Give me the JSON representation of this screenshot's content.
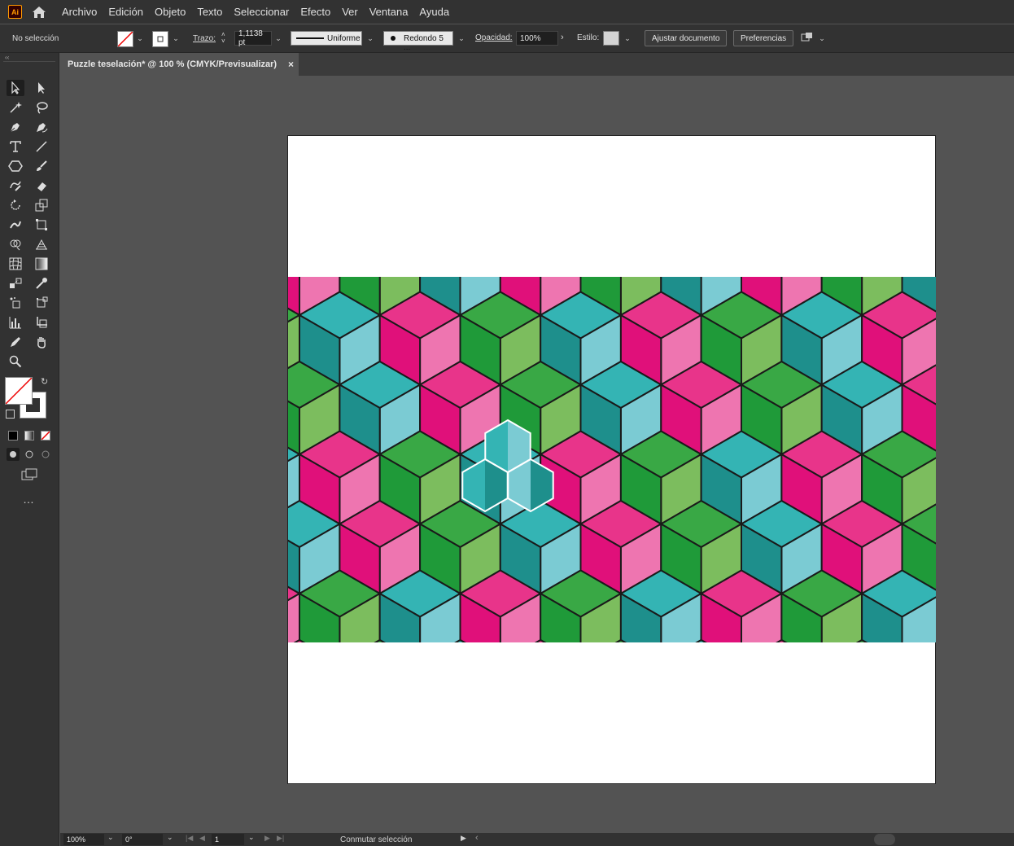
{
  "app": {
    "logo": "Ai"
  },
  "menu": [
    "Archivo",
    "Edición",
    "Objeto",
    "Texto",
    "Seleccionar",
    "Efecto",
    "Ver",
    "Ventana",
    "Ayuda"
  ],
  "control": {
    "selection": "No selección",
    "stroke_label": "Trazo:",
    "stroke_value": "1,1138 pt",
    "profile": "Uniforme",
    "brush": "Redondo 5 ...",
    "opacity_label": "Opacidad:",
    "opacity_value": "100%",
    "style_label": "Estilo:",
    "fit_button": "Ajustar documento",
    "prefs_button": "Preferencias"
  },
  "document": {
    "tab_title": "Puzzle teselación* @ 100 % (CMYK/Previsualizar)",
    "close": "×"
  },
  "status": {
    "zoom": "100%",
    "rotation": "0°",
    "artboard": "1",
    "toggle": "Conmutar selección"
  },
  "colors": {
    "pink": [
      "#e8348a",
      "#ee75b0",
      "#e0107a"
    ],
    "green": [
      "#39a845",
      "#7cbd5e",
      "#1f9a39"
    ],
    "teal": [
      "#34b4b4",
      "#7bcbd3",
      "#1e8f8c"
    ],
    "background": "#535353",
    "panel": "#323232"
  },
  "icons": [
    "selection-tool-icon",
    "direct-selection-tool-icon",
    "magic-wand-icon",
    "lasso-icon",
    "pen-icon",
    "curvature-icon",
    "type-icon",
    "line-icon",
    "polygon-icon",
    "paintbrush-icon",
    "shaper-icon",
    "eraser-icon",
    "rotate-icon",
    "scale-icon",
    "warp-icon",
    "free-transform-icon",
    "shape-builder-icon",
    "perspective-grid-icon",
    "mesh-icon",
    "gradient-icon",
    "eyedropper-icon",
    "blend-icon",
    "symbol-sprayer-icon",
    "column-graph-icon",
    "artboard-icon",
    "slice-icon",
    "hand-icon",
    "zoom-icon"
  ]
}
